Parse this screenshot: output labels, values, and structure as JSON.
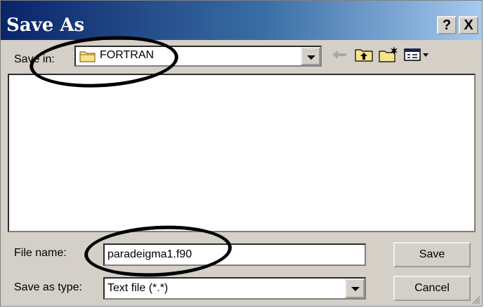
{
  "dialog": {
    "title": "Save As",
    "help_label": "?",
    "close_label": "X"
  },
  "save_in": {
    "label": "Save in:",
    "folder": "FORTRAN"
  },
  "file_name": {
    "label": "File name:",
    "value": "paradeigma1.f90"
  },
  "save_as_type": {
    "label": "Save as type:",
    "value": "Text file (*.*)"
  },
  "buttons": {
    "save_label": "Save",
    "cancel_label": "Cancel"
  },
  "colors": {
    "title_start": "#0a246a",
    "title_end": "#a6caf0",
    "dialog_face": "#d4d0c8",
    "annotation": "#000000"
  },
  "icons": [
    "folder-icon",
    "back-arrow-icon",
    "up-folder-icon",
    "new-folder-icon",
    "view-menu-icon"
  ]
}
